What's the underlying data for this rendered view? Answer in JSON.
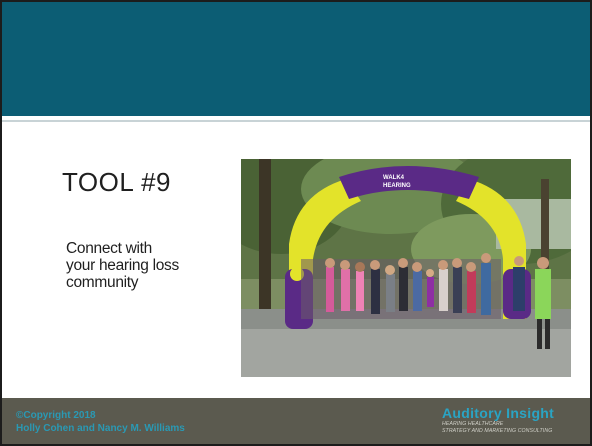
{
  "slide": {
    "title": "TOOL #9",
    "body_lines": [
      "Connect with",
      "your hearing loss",
      "community"
    ],
    "photo": {
      "description_icon": "photo-icon",
      "arch_banner_text_line1": "WALK4",
      "arch_banner_text_line2": "HEARING"
    }
  },
  "footer": {
    "copyright_line1": "©Copyright 2018",
    "copyright_line2": "Holly Cohen and Nancy M. Williams",
    "brand_name": "Auditory Insight",
    "brand_tag_line1": "HEARING HEALTHCARE",
    "brand_tag_line2": "STRATEGY AND MARKETING CONSULTING"
  },
  "colors": {
    "header": "#0c5d74",
    "footer": "#5b5a4f",
    "accent": "#2aa4c4",
    "arch_yellow": "#e3e32a",
    "arch_purple": "#5a2a86"
  }
}
